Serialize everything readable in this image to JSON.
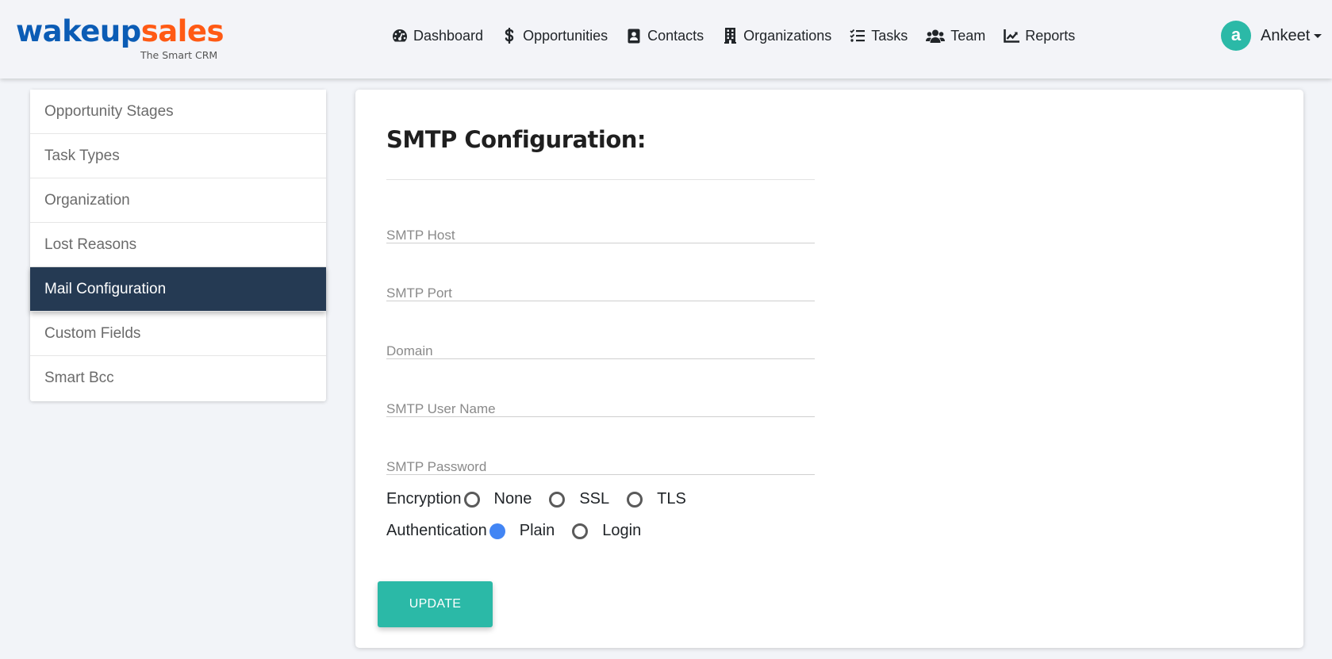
{
  "brand": {
    "name_part1": "wakeup",
    "name_part2": "sales",
    "tagline": "The Smart CRM",
    "colors": {
      "blue": "#0b5cb5",
      "orange": "#ff5a14"
    }
  },
  "nav": {
    "items": [
      {
        "label": "Dashboard",
        "icon": "tachometer-icon"
      },
      {
        "label": "Opportunities",
        "icon": "dollar-icon"
      },
      {
        "label": "Contacts",
        "icon": "address-book-icon"
      },
      {
        "label": "Organizations",
        "icon": "building-icon"
      },
      {
        "label": "Tasks",
        "icon": "tasks-icon"
      },
      {
        "label": "Team",
        "icon": "users-icon"
      },
      {
        "label": "Reports",
        "icon": "chart-line-icon"
      }
    ]
  },
  "user": {
    "avatar_letter": "a",
    "name": "Ankeet",
    "avatar_color": "#2bb9a7"
  },
  "sidebar": {
    "items": [
      {
        "label": "Opportunity Stages",
        "active": false
      },
      {
        "label": "Task Types",
        "active": false
      },
      {
        "label": "Organization",
        "active": false
      },
      {
        "label": "Lost Reasons",
        "active": false
      },
      {
        "label": "Mail Configuration",
        "active": true
      },
      {
        "label": "Custom Fields",
        "active": false
      },
      {
        "label": "Smart Bcc",
        "active": false
      }
    ],
    "active_color": "#253a53"
  },
  "form": {
    "title": "SMTP Configuration:",
    "fields": [
      {
        "placeholder": "SMTP Host",
        "value": ""
      },
      {
        "placeholder": "SMTP Port",
        "value": ""
      },
      {
        "placeholder": "Domain",
        "value": ""
      },
      {
        "placeholder": "SMTP User Name",
        "value": ""
      },
      {
        "placeholder": "SMTP Password",
        "value": ""
      }
    ],
    "encryption": {
      "label": "Encryption",
      "options": [
        "None",
        "SSL",
        "TLS"
      ],
      "selected": null
    },
    "authentication": {
      "label": "Authentication",
      "options": [
        "Plain",
        "Login"
      ],
      "selected": "Plain"
    },
    "update_label": "UPDATE",
    "accent_color": "#2bb9a7",
    "radio_checked_color": "#4285f4"
  }
}
